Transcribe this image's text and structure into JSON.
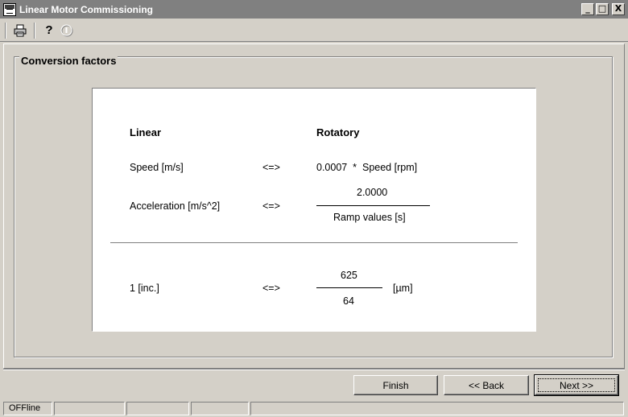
{
  "window": {
    "title": "Linear Motor Commissioning",
    "minimize": "_",
    "maximize": "□",
    "close": "X"
  },
  "toolbar": {
    "print_icon": "🖶",
    "help_icon": "?",
    "info_icon": "i"
  },
  "group": {
    "title": "Conversion factors"
  },
  "conversion": {
    "header_linear": "Linear",
    "header_rotatory": "Rotatory",
    "speed_linear": "Speed [m/s]",
    "speed_arrow": "<=>",
    "speed_rotatory": "0.0007  *  Speed [rpm]",
    "accel_linear": "Acceleration [m/s^2]",
    "accel_arrow": "<=>",
    "accel_numerator": "2.0000",
    "accel_denominator": "Ramp values [s]",
    "inc_linear": "1 [inc.]",
    "inc_arrow": "<=>",
    "inc_numerator": "625",
    "inc_denominator": "64",
    "inc_unit": "[µm]"
  },
  "buttons": {
    "finish": "Finish",
    "back": "<< Back",
    "next": "Next >>"
  },
  "status": {
    "mode": "OFFline"
  }
}
